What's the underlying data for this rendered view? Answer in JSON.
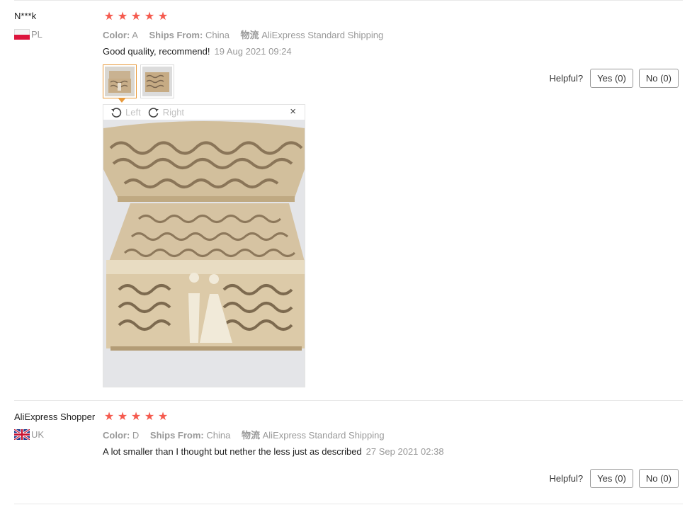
{
  "reviews": [
    {
      "user": "N***k",
      "country_code": "PL",
      "rating": 5,
      "color_label": "Color:",
      "color_value": "A",
      "ships_label": "Ships From:",
      "ships_value": "China",
      "logistics_label": "物流",
      "logistics_value": "AliExpress Standard Shipping",
      "text": "Good quality, recommend!",
      "date": "19 Aug 2021 09:24",
      "helpful_label": "Helpful?",
      "yes_label": "Yes (0)",
      "no_label": "No (0)",
      "viewer": {
        "left_label": "Left",
        "right_label": "Right",
        "close_symbol": "×"
      }
    },
    {
      "user": "AliExpress Shopper",
      "country_code": "UK",
      "rating": 5,
      "color_label": "Color:",
      "color_value": "D",
      "ships_label": "Ships From:",
      "ships_value": "China",
      "logistics_label": "物流",
      "logistics_value": "AliExpress Standard Shipping",
      "text": "A lot smaller than I thought but nether the less just as described",
      "date": "27 Sep 2021 02:38",
      "helpful_label": "Helpful?",
      "yes_label": "Yes (0)",
      "no_label": "No (0)"
    }
  ],
  "colors": {
    "star": "#f55a4e",
    "muted": "#999999",
    "accent_border": "#e89a3c"
  },
  "icons": [
    "rotate-left-icon",
    "rotate-right-icon",
    "close-icon",
    "star-icon",
    "flag-pl-icon",
    "flag-uk-icon"
  ]
}
